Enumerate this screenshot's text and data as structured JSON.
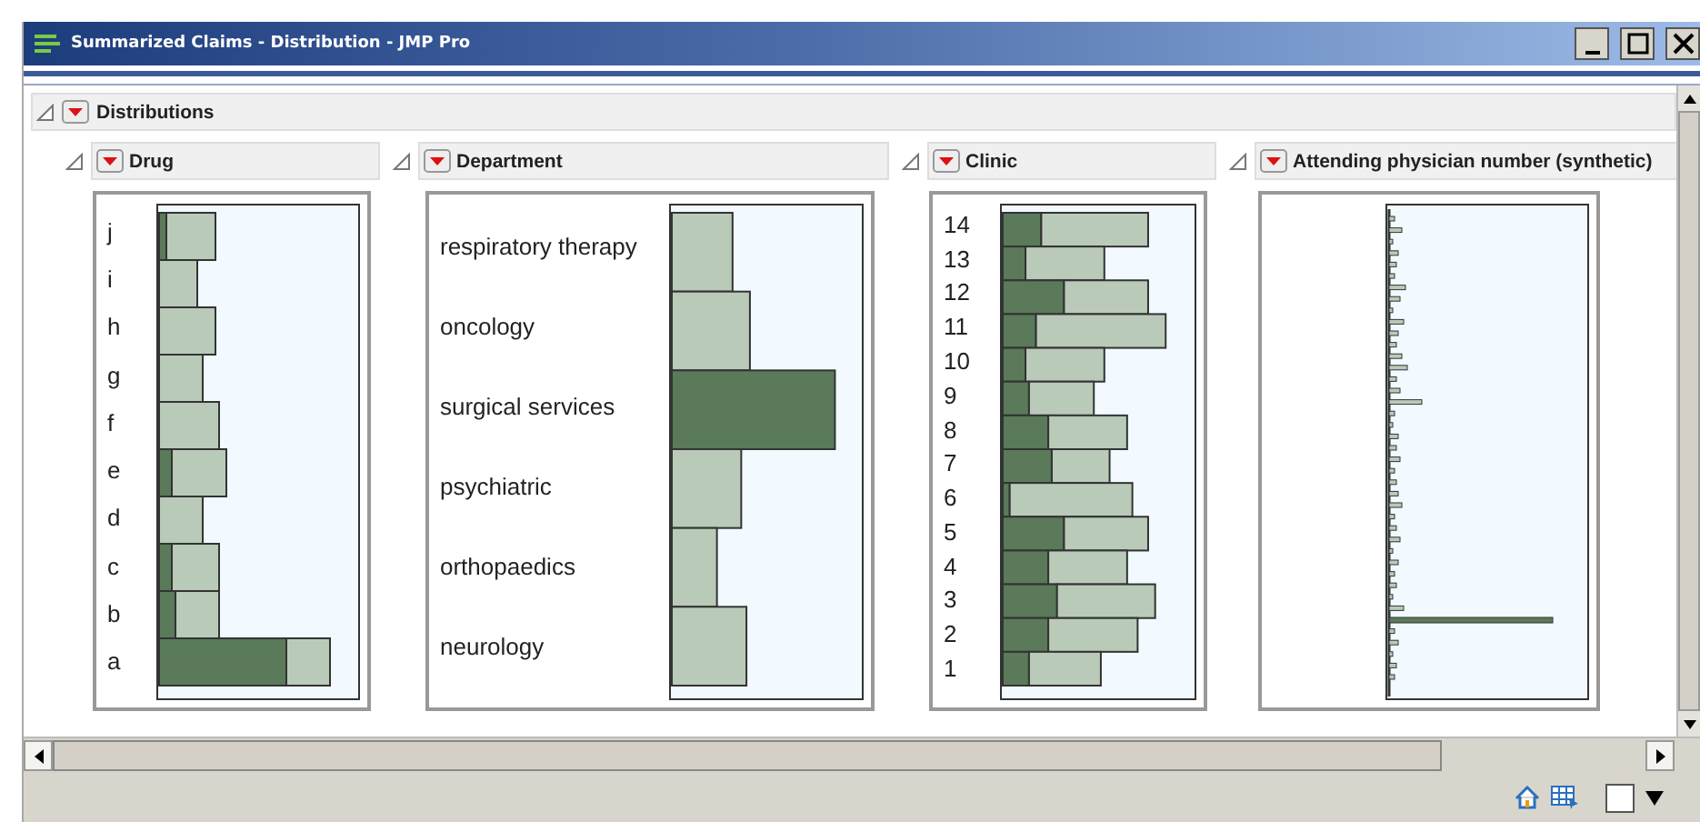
{
  "window": {
    "title": "Summarized Claims - Distribution - JMP Pro"
  },
  "report": {
    "title": "Distributions",
    "panels": [
      {
        "title": "Drug",
        "kind": "bars",
        "labels": [
          "j",
          "i",
          "h",
          "g",
          "f",
          "e",
          "d",
          "c",
          "b",
          "a"
        ]
      },
      {
        "title": "Department",
        "kind": "bars",
        "labels": [
          "respiratory therapy",
          "oncology",
          "surgical services",
          "psychiatric",
          "orthopaedics",
          "neurology"
        ]
      },
      {
        "title": "Clinic",
        "kind": "bars",
        "labels": [
          "14",
          "13",
          "12",
          "11",
          "10",
          "9",
          "8",
          "7",
          "6",
          "5",
          "4",
          "3",
          "2",
          "1"
        ]
      },
      {
        "title": "Attending physician number (synthetic)",
        "kind": "sparse"
      }
    ]
  }
}
